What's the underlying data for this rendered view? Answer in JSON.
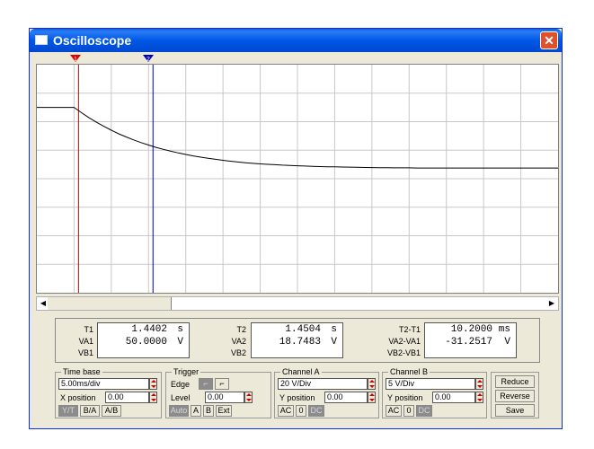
{
  "window": {
    "title": "Oscilloscope",
    "close_glyph": "✕",
    "colors": {
      "titlebar": "#0a5ee6",
      "panel": "#ece9d8",
      "cursor1": "#e00000",
      "cursor2": "#0000c0",
      "trace": "#000000"
    }
  },
  "screen": {
    "cursor1_label": "1",
    "cursor2_label": "2",
    "grid": true
  },
  "scrollbar": {
    "left_arrow": "◀",
    "right_arrow": "▶"
  },
  "chart_data": {
    "type": "line",
    "x": [
      0,
      1,
      2,
      3,
      4,
      5,
      6,
      7,
      8,
      9,
      10,
      11,
      12,
      13,
      14,
      15,
      16,
      17,
      18,
      19,
      20,
      21,
      22,
      23,
      24,
      25,
      26,
      27,
      28,
      29,
      30,
      31,
      32,
      33,
      34,
      35,
      36,
      37,
      38,
      39,
      40,
      41,
      42,
      43,
      44,
      45,
      46,
      47,
      48,
      49,
      50,
      51,
      52,
      53,
      54,
      55,
      56,
      57,
      58,
      59,
      60,
      61,
      62,
      63,
      64,
      65,
      66,
      67,
      68,
      69,
      70
    ],
    "series": [
      {
        "values": [
          50,
          50,
          50,
          50,
          50,
          50,
          46.3,
          42.8,
          39.6,
          36.7,
          34,
          31.5,
          29.3,
          27.2,
          25.3,
          23.6,
          22,
          20.6,
          19.3,
          18.1,
          17,
          16,
          15.1,
          14.3,
          13.6,
          12.9,
          12.3,
          11.7,
          11.2,
          10.8,
          10.4,
          10.1,
          9.8,
          9.5,
          9.3,
          9.1,
          8.9,
          8.7,
          8.5,
          8.4,
          8.3,
          8.2,
          8.1,
          8,
          7.9,
          7.8,
          7.7,
          7.7,
          7.6,
          7.6,
          7.6,
          7.5,
          7.5,
          7.5,
          7.5,
          7.5,
          7.5,
          7.5,
          7.5,
          7.5,
          7.5,
          7.5,
          7.5,
          7.5,
          7.5,
          7.5,
          7.5,
          7.5,
          7.5,
          7.5,
          7.5
        ]
      }
    ],
    "xlim": [
      0,
      70
    ],
    "ylim": [
      -80,
      80
    ],
    "cursor1_x": 5.6,
    "cursor2_x": 15.6
  },
  "readout": {
    "t1": {
      "labels": [
        "T1",
        "VA1",
        "VB1"
      ],
      "values": [
        "1.4402",
        "50.0000",
        ""
      ],
      "units": [
        "s",
        "V",
        ""
      ]
    },
    "t2": {
      "labels": [
        "T2",
        "VA2",
        "VB2"
      ],
      "values": [
        "1.4504",
        "18.7483",
        ""
      ],
      "units": [
        "s",
        "V",
        ""
      ]
    },
    "diff": {
      "labels": [
        "T2-T1",
        "VA2-VA1",
        "VB2-VB1"
      ],
      "values": [
        "10.2000",
        "-31.2517",
        ""
      ],
      "units": [
        "ms",
        "V",
        ""
      ]
    }
  },
  "timebase": {
    "label": "Time base",
    "scale": "5.00ms/div",
    "xpos_label": "X position",
    "xpos": "0.00",
    "modes": [
      "Y/T",
      "B/A",
      "A/B"
    ]
  },
  "trigger": {
    "label": "Trigger",
    "edge_label": "Edge",
    "edge_buttons": [
      "⌐",
      "⌐"
    ],
    "level_label": "Level",
    "level": "0.00",
    "sources": [
      "Auto",
      "A",
      "B",
      "Ext"
    ]
  },
  "channel_a": {
    "label": "Channel A",
    "scale": "20 V/Div",
    "ypos_label": "Y position",
    "ypos": "0.00",
    "coupling": [
      "AC",
      "0",
      "DC"
    ]
  },
  "channel_b": {
    "label": "Channel B",
    "scale": "5 V/Div",
    "ypos_label": "Y position",
    "ypos": "0.00",
    "coupling": [
      "AC",
      "0",
      "DC"
    ]
  },
  "side_buttons": {
    "reduce": "Reduce",
    "reverse": "Reverse",
    "save": "Save"
  }
}
